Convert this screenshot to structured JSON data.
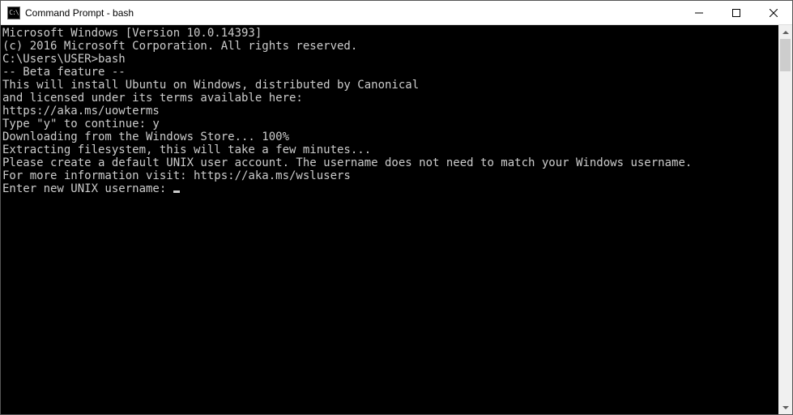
{
  "window": {
    "title": "Command Prompt - bash",
    "icon_label": "C:\\"
  },
  "terminal": {
    "lines": [
      "Microsoft Windows [Version 10.0.14393]",
      "(c) 2016 Microsoft Corporation. All rights reserved.",
      "",
      "C:\\Users\\USER>bash",
      "-- Beta feature --",
      "This will install Ubuntu on Windows, distributed by Canonical",
      "and licensed under its terms available here:",
      "https://aka.ms/uowterms",
      "",
      "Type \"y\" to continue: y",
      "Downloading from the Windows Store... 100%",
      "Extracting filesystem, this will take a few minutes...",
      "Please create a default UNIX user account. The username does not need to match your Windows username.",
      "For more information visit: https://aka.ms/wslusers",
      "Enter new UNIX username: "
    ]
  }
}
